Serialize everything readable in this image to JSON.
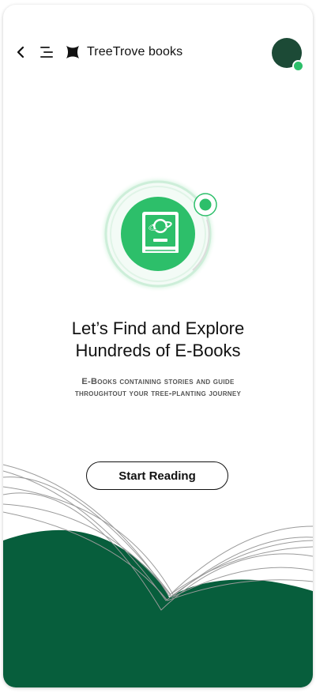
{
  "header": {
    "back_icon": "chevron-left-icon",
    "menu_icon": "menu-lines-icon",
    "logo_icon": "treetrove-logo-icon",
    "brand_name": "TreeTrove books",
    "avatar_icon": "user-avatar"
  },
  "hero": {
    "icon": "book-planet-icon",
    "headline_line1": "Let’s Find and Explore",
    "headline_line2": "Hundreds of E-Books",
    "subtext_line1": "E-Books containing stories and guide",
    "subtext_line2": "throughtout your tree-planting journey"
  },
  "cta": {
    "start_label": "Start Reading"
  },
  "colors": {
    "brand_dark_green": "#075e3c",
    "accent_green": "#2dbf6a",
    "avatar_green": "#1c4a36",
    "text_dark": "#111111",
    "text_muted": "#555555"
  }
}
